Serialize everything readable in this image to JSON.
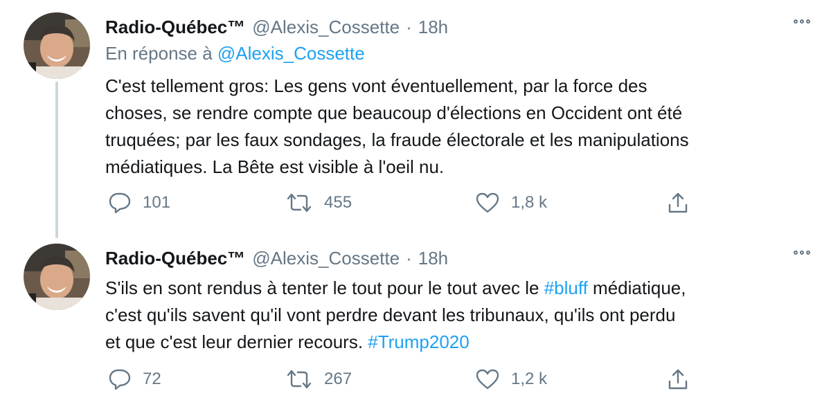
{
  "tweets": [
    {
      "author_name": "Radio-Québec™",
      "author_handle": "@Alexis_Cossette",
      "separator": "·",
      "time": "18h",
      "reply_prefix": "En réponse à",
      "reply_to": "@Alexis_Cossette",
      "lines": [
        "C'est tellement gros: Les gens vont éventuellement, par la force des",
        "choses, se rendre compte que beaucoup d'élections en Occident ont été",
        "truquées; par les faux sondages, la fraude électorale et les manipulations",
        "médiatiques. La Bête est visible à l'oeil nu."
      ],
      "replies": "101",
      "retweets": "455",
      "likes": "1,8 k"
    },
    {
      "author_name": "Radio-Québec™",
      "author_handle": "@Alexis_Cossette",
      "separator": "·",
      "time": "18h",
      "line1_pre": "S'ils en sont rendus à tenter le tout pour le tout avec le ",
      "line1_hashtag": "#bluff",
      "line1_post": " médiatique,",
      "line2": "c'est qu'ils savent qu'il vont perdre devant les tribunaux, qu'ils ont perdu",
      "line3_pre": "et que c'est leur dernier recours. ",
      "line3_hashtag": "#Trump2020",
      "replies": "72",
      "retweets": "267",
      "likes": "1,2 k"
    }
  ],
  "icons": {
    "reply": "reply-icon",
    "retweet": "retweet-icon",
    "like": "like-icon",
    "share": "share-icon",
    "more": "more-icon"
  },
  "colors": {
    "text": "#14171a",
    "secondary": "#657786",
    "link": "#1da1f2",
    "thread_line": "#ccd6dd"
  }
}
